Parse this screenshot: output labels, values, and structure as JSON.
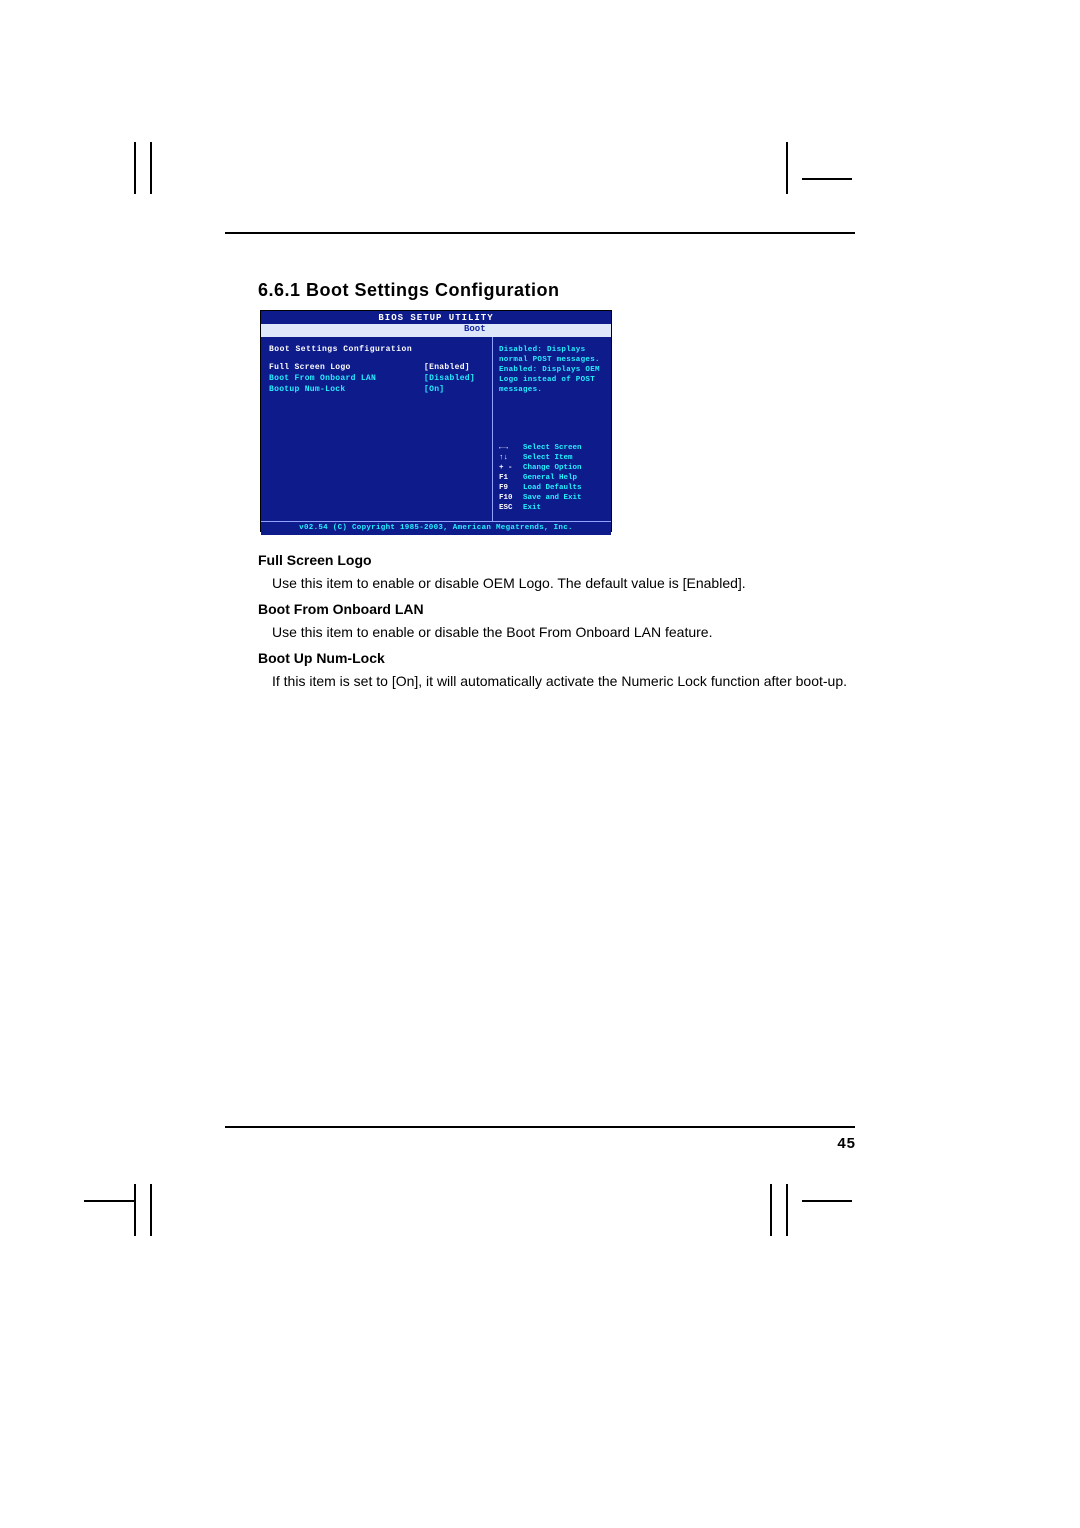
{
  "heading": "6.6.1  Boot Settings Configuration",
  "page_number": "45",
  "bios": {
    "title": "BIOS SETUP UTILITY",
    "active_tab": "Boot",
    "section_title": "Boot Settings Configuration",
    "settings": [
      {
        "label": "Full Screen Logo",
        "value": "[Enabled]"
      },
      {
        "label": "Boot From Onboard LAN",
        "value": "[Disabled]"
      },
      {
        "label": "Bootup Num-Lock",
        "value": "[On]"
      }
    ],
    "help_text": "Disabled: Displays normal POST messages. Enabled: Displays OEM Logo instead of POST messages.",
    "keys": [
      {
        "key": "←→",
        "action": "Select Screen"
      },
      {
        "key": "↑↓",
        "action": "Select Item"
      },
      {
        "key": "+ -",
        "action": "Change Option"
      },
      {
        "key": "F1",
        "action": "General Help"
      },
      {
        "key": "F9",
        "action": "Load Defaults"
      },
      {
        "key": "F10",
        "action": "Save and Exit"
      },
      {
        "key": "ESC",
        "action": "Exit"
      }
    ],
    "copyright": "v02.54 (C) Copyright 1985-2003, American Megatrends, Inc."
  },
  "items": [
    {
      "title": "Full Screen Logo",
      "body": "Use this item to enable or disable OEM Logo. The default value is [Enabled]."
    },
    {
      "title": "Boot From Onboard LAN",
      "body": "Use this item to enable or disable the Boot From Onboard LAN feature."
    },
    {
      "title": "Boot Up Num-Lock",
      "body": "If this item is set to [On], it will automatically activate the Numeric Lock function after boot-up."
    }
  ]
}
